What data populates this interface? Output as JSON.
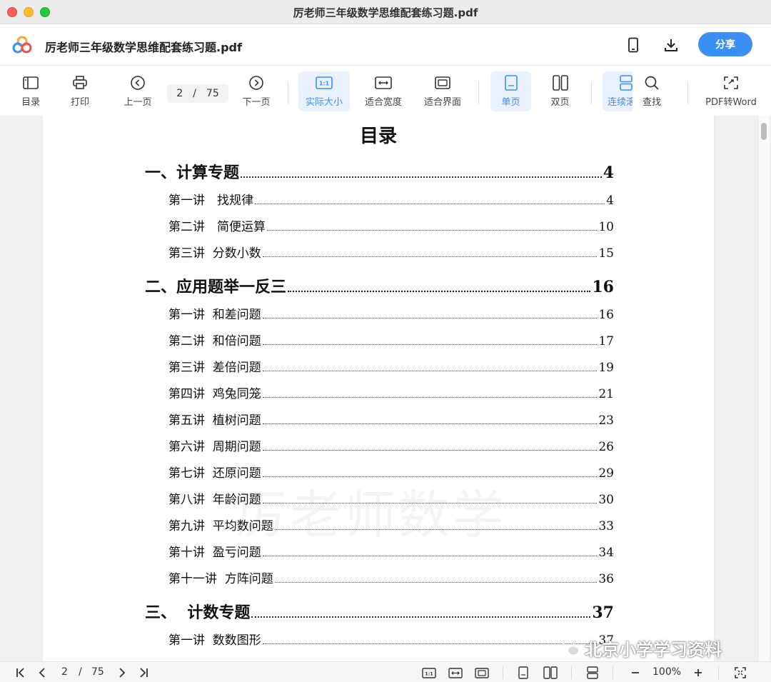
{
  "window": {
    "title": "厉老师三年级数学思维配套练习题.pdf"
  },
  "header": {
    "filename": "厉老师三年级数学思维配套练习题.pdf",
    "share_label": "分享",
    "icons": [
      "cloud-logo-icon",
      "phone-icon",
      "download-icon"
    ]
  },
  "toolbar": {
    "toc_label": "目录",
    "print_label": "打印",
    "prev_label": "上一页",
    "current_page": "2",
    "page_separator": "/",
    "total_pages": "75",
    "next_label": "下一页",
    "actual_size_label": "实际大小",
    "fit_width_label": "适合宽度",
    "fit_page_label": "适合界面",
    "single_page_label": "单页",
    "double_page_label": "双页",
    "continuous_label": "连续滚",
    "find_label": "查找",
    "pdf_to_word_label": "PDF转Word",
    "accent_color": "#3a8ff5"
  },
  "document": {
    "title": "目录",
    "watermark": "厉老师数学",
    "overlay_text": "北京小学学习资料",
    "entries": [
      {
        "type": "section",
        "label": "一、计算专题",
        "page": "4"
      },
      {
        "type": "lecture",
        "label": "第一讲　找规律",
        "page": "4"
      },
      {
        "type": "lecture",
        "label": "第二讲　简便运算",
        "page": "10"
      },
      {
        "type": "lecture",
        "label": "第三讲  分数小数",
        "page": "15"
      },
      {
        "type": "section",
        "label": "二、应用题举一反三",
        "page": "16"
      },
      {
        "type": "lecture",
        "label": "第一讲  和差问题",
        "page": "16"
      },
      {
        "type": "lecture",
        "label": "第二讲  和倍问题",
        "page": "17"
      },
      {
        "type": "lecture",
        "label": "第三讲  差倍问题",
        "page": "19"
      },
      {
        "type": "lecture",
        "label": "第四讲  鸡兔同笼",
        "page": "21"
      },
      {
        "type": "lecture",
        "label": "第五讲  植树问题",
        "page": "23"
      },
      {
        "type": "lecture",
        "label": "第六讲  周期问题",
        "page": "26"
      },
      {
        "type": "lecture",
        "label": "第七讲  还原问题",
        "page": "29"
      },
      {
        "type": "lecture",
        "label": "第八讲  年龄问题",
        "page": "30"
      },
      {
        "type": "lecture",
        "label": "第九讲  平均数问题",
        "page": "33"
      },
      {
        "type": "lecture",
        "label": "第十讲  盈亏问题",
        "page": "34"
      },
      {
        "type": "lecture",
        "label": "第十一讲  方阵问题",
        "page": "36"
      },
      {
        "type": "section",
        "label": "三、  计数专题",
        "page": "37"
      },
      {
        "type": "lecture",
        "label": "第一讲  数数图形",
        "page": "37"
      }
    ]
  },
  "statusbar": {
    "current_page": "2",
    "page_separator": "/",
    "total_pages": "75",
    "zoom": "100%"
  }
}
